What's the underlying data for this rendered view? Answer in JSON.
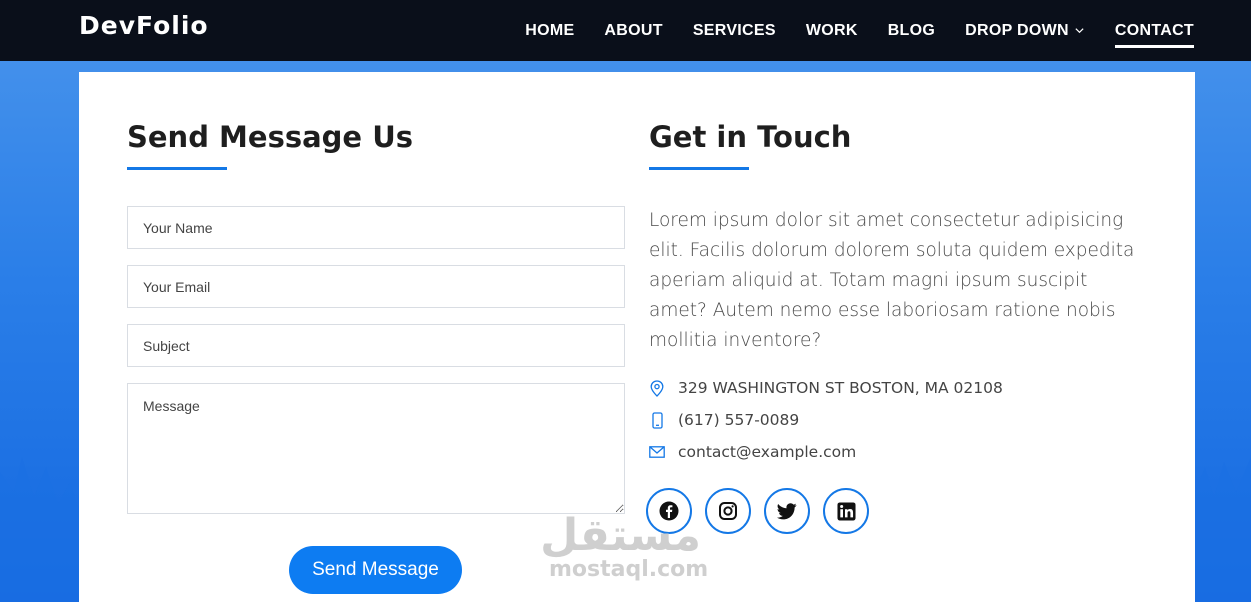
{
  "brand": "DevFolio",
  "nav": {
    "items": [
      "HOME",
      "ABOUT",
      "SERVICES",
      "WORK",
      "BLOG",
      "DROP DOWN",
      "CONTACT"
    ],
    "active": "CONTACT"
  },
  "form": {
    "title": "Send Message Us",
    "name_placeholder": "Your Name",
    "email_placeholder": "Your Email",
    "subject_placeholder": "Subject",
    "message_placeholder": "Message",
    "submit_label": "Send Message"
  },
  "contact": {
    "title": "Get in Touch",
    "description": "Lorem ipsum dolor sit amet consectetur adipisicing elit. Facilis dolorum dolorem soluta quidem expedita aperiam aliquid at. Totam magni ipsum suscipit amet? Autem nemo esse laboriosam ratione nobis mollitia inventore?",
    "address": "329 WASHINGTON ST BOSTON, MA 02108",
    "phone": "(617) 557-0089",
    "email": "contact@example.com",
    "socials": [
      {
        "icon": "facebook-icon"
      },
      {
        "icon": "instagram-icon"
      },
      {
        "icon": "twitter-icon"
      },
      {
        "icon": "linkedin-icon"
      }
    ]
  },
  "watermark": {
    "arabic": "مستقل",
    "latin": "mostaql.com"
  },
  "colors": {
    "accent": "#1478e6",
    "button": "#0d7cf2",
    "navbar": "#0a0f1a",
    "background": "#2b7fe8"
  }
}
